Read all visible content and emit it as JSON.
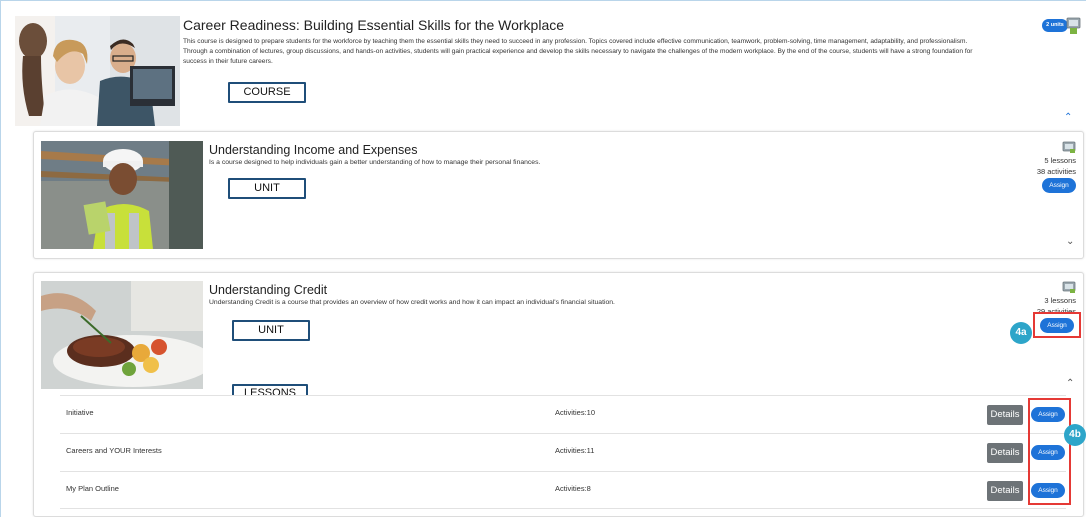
{
  "course": {
    "title": "Career Readiness: Building Essential Skills for the Workplace",
    "description": "This course is designed to prepare students for the workforce by teaching them the essential skills they need to succeed in any profession. Topics covered include effective communication, teamwork, problem-solving, time management, adaptability, and professionalism. Through a combination of lectures, group discussions, and hands-on activities, students will gain practical experience and develop the skills necessary to navigate the challenges of the modern workplace. By the end of the course, students will have a strong foundation for success in their future careers.",
    "units_badge": "2 units",
    "label": "COURSE",
    "collapse_icon": "chevron-up-icon"
  },
  "units": [
    {
      "title": "Understanding Income and Expenses",
      "description": "Is a course designed to help individuals gain a better understanding of how to manage their personal finances.",
      "lessons": "5 lessons",
      "activities": "38 activities",
      "assign_label": "Assign",
      "label": "UNIT",
      "expand_icon": "chevron-down-icon"
    },
    {
      "title": "Understanding Credit",
      "description": "Understanding Credit is a course that provides an overview of how credit works and how it can impact an individual's financial situation.",
      "lessons": "3 lessons",
      "activities": "29 activities",
      "assign_label": "Assign",
      "label": "UNIT",
      "lessons_label": "LESSONS",
      "collapse_icon": "chevron-up-icon"
    }
  ],
  "lesson_rows": [
    {
      "name": "Initiative",
      "activities": "Activities:10",
      "details_label": "Details",
      "assign_label": "Assign"
    },
    {
      "name": "Careers and YOUR Interests",
      "activities": "Activities:11",
      "details_label": "Details",
      "assign_label": "Assign"
    },
    {
      "name": "My Plan Outline",
      "activities": "Activities:8",
      "details_label": "Details",
      "assign_label": "Assign"
    }
  ],
  "callouts": {
    "a": "4a",
    "b": "4b"
  },
  "colors": {
    "accent": "#1e73d8",
    "callout": "#2da5c9",
    "highlight": "#e53935",
    "label_border": "#1f4e79"
  }
}
